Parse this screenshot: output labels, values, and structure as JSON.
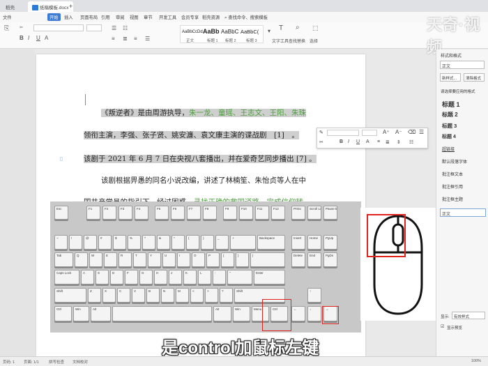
{
  "titlebar": {
    "tabs": [
      {
        "label": "稻壳"
      },
      {
        "label": "纸稿模板.docx"
      }
    ]
  },
  "menu": {
    "items": [
      "文件",
      "开始",
      "插入",
      "页面布局",
      "引用",
      "审阅",
      "视图",
      "章节",
      "开发工具",
      "会员专享",
      "稻壳资源",
      "查找命令、搜索模板"
    ],
    "active_index": 1
  },
  "ribbon": {
    "styles": [
      {
        "preview": "AaBbCcDd",
        "label": "正文"
      },
      {
        "preview": "AaBb",
        "label": "标题 1"
      },
      {
        "preview": "AaBbC",
        "label": "标题 2"
      },
      {
        "preview": "AaBbC(",
        "label": "标题 3"
      }
    ],
    "text_tools_label": "文字工具",
    "find_replace_label": "查找替换",
    "select_label": "选择"
  },
  "watermark": "天奇·视频",
  "document": {
    "line1_pre": "《叛逆者》是由周游执导，",
    "line1_green": "朱一龙、童瑶、王志文、王阳、朱珠",
    "line2": "领衔主演，李强、张子贤、姚安濂、袁文康主演的谍战剧　[1]　。",
    "line3": "该剧于 2021 年 6 月 7 日在央视八套播出，并在爱奇艺同步播出 [7] 。",
    "line4": "该剧根据畀愚的同名小说改编，讲述了林楠笙、朱怡贞等人在中",
    "line5_pre": "国共产党员的指引下，经过困惑、",
    "line5_green": "寻找正确的救国道路，完成信仰转"
  },
  "right_panel": {
    "title": "样式和格式",
    "current": "正文",
    "new_style": "新样式...",
    "clear_format": "清除格式",
    "section_label": "请选择要应用的格式",
    "styles": [
      "标题 1",
      "标题 2",
      "标题 3",
      "标题 4",
      "超链接",
      "默认段落字体",
      "批注框文本",
      "批注框引用",
      "批注框主题",
      "正文"
    ],
    "show_label": "显示:",
    "show_value": "有效样式",
    "preview_label": "显示预览"
  },
  "keyboard": {
    "fn_row": [
      "Esc",
      "F1",
      "F2",
      "F3",
      "F4",
      "F5",
      "F6",
      "F7",
      "F8",
      "F9",
      "F10",
      "F11",
      "F12",
      "PrtSc",
      "Scroll Lock",
      "Pause Break"
    ],
    "num_row": [
      "~",
      "!",
      "@",
      "#",
      "$",
      "%",
      "^",
      "&",
      "*",
      "(",
      ")",
      "_",
      "+",
      "Backspace",
      "Insert",
      "Home",
      "PgUp"
    ],
    "tab_row": [
      "Tab",
      "Q",
      "W",
      "E",
      "R",
      "T",
      "Y",
      "U",
      "I",
      "O",
      "P",
      "{",
      "}",
      "|",
      "Delete",
      "End",
      "PgDn"
    ],
    "caps_row": [
      "Caps Lock",
      "A",
      "S",
      "D",
      "F",
      "G",
      "H",
      "J",
      "K",
      "L",
      ":",
      "\"",
      "Enter"
    ],
    "shift_row": [
      "Shift",
      "Z",
      "X",
      "C",
      "V",
      "B",
      "N",
      "M",
      "<",
      ">",
      "?",
      "Shift",
      "↑"
    ],
    "ctrl_row": [
      "Ctrl",
      "Win",
      "Alt",
      "",
      "Alt",
      "Win",
      "Menu",
      "Ctrl",
      "←",
      "↓",
      "→"
    ]
  },
  "subtitle": "是control加鼠标左键",
  "status": {
    "page": "页码: 1",
    "pages": "页面: 1/1",
    "spell": "拼写检查",
    "doc_check": "文档校对",
    "zoom": "100%"
  },
  "colors": {
    "highlight_red": "#e0221f",
    "menu_active": "#3d7bd6",
    "green_text": "#4a9d3a"
  }
}
